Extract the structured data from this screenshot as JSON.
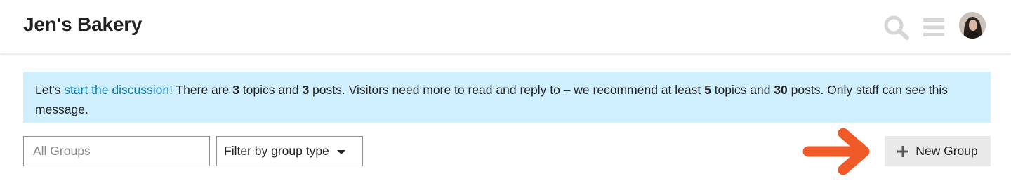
{
  "header": {
    "site_title": "Jen's Bakery",
    "icons": [
      "search-icon",
      "hamburger-menu-icon",
      "user-avatar"
    ]
  },
  "notice": {
    "prefix": "Let's ",
    "link_text": "start the discussion!",
    "text1": " There are ",
    "topics_count": "3",
    "text2": " topics and ",
    "posts_count": "3",
    "text3": " posts. Visitors need more to read and reply to – we recommend at least ",
    "rec_topics": "5",
    "text4": " topics and ",
    "rec_posts": "30",
    "text5": " posts. Only staff can see this message."
  },
  "filters": {
    "search_placeholder": "All Groups",
    "type_filter_label": "Filter by group type"
  },
  "actions": {
    "new_group_label": "New Group"
  },
  "colors": {
    "notice_bg": "#d1f0ff",
    "link": "#0a78b3",
    "arrow": "#f05a28",
    "button_bg": "#e9e9e9",
    "icon_gray": "#d6d6d6"
  }
}
